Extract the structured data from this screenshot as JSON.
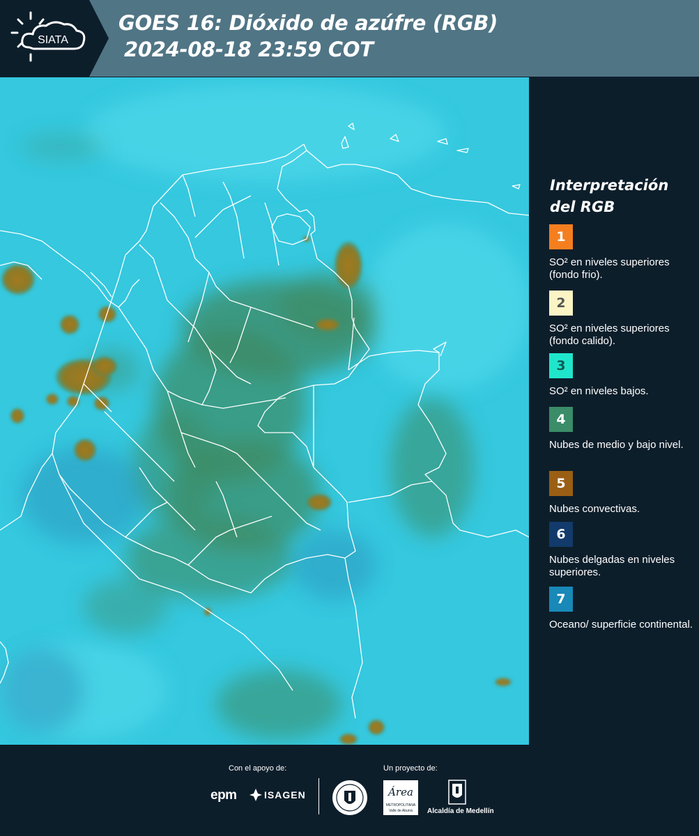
{
  "header": {
    "logo_text": "SIATA",
    "title_line1": "GOES 16: Dióxido de azúfre (RGB)",
    "title_line2": "2024-08-18 23:59 COT"
  },
  "map": {
    "ocean_color": "#35c8df",
    "border_color": "#ffffff"
  },
  "legend": {
    "title": "Interpretación del RGB",
    "items": [
      {
        "number": "1",
        "color": "#f57f1f",
        "text_color": "#ffffff",
        "label": "SO² en niveles superiores (fondo frio)."
      },
      {
        "number": "2",
        "color": "#fbf5c5",
        "text_color": "#555555",
        "label": "SO² en niveles superiores (fondo calido)."
      },
      {
        "number": "3",
        "color": "#1fe6cb",
        "text_color": "#0d5c55",
        "label": "SO² en niveles bajos."
      },
      {
        "number": "4",
        "color": "#3b8c68",
        "text_color": "#ffffff",
        "label": "Nubes de medio y bajo nivel."
      },
      {
        "number": "5",
        "color": "#9a5f14",
        "text_color": "#ffffff",
        "label": "Nubes convectivas."
      },
      {
        "number": "6",
        "color": "#123a6b",
        "text_color": "#ffffff",
        "label": "Nubes delgadas en niveles superiores."
      },
      {
        "number": "7",
        "color": "#1889b8",
        "text_color": "#ffffff",
        "label": "Oceano/ superficie continental."
      }
    ]
  },
  "footer": {
    "support_caption": "Con el apoyo de:",
    "project_caption": "Un proyecto de:",
    "epm_logo": "epm",
    "isagen_logo": "ISAGEN",
    "area_logo_script": "Área",
    "area_logo_sub1": "METROPOLITANA",
    "area_logo_sub2": "Valle de Aburrá",
    "alcaldia_logo": "Alcaldía de Medellín"
  }
}
